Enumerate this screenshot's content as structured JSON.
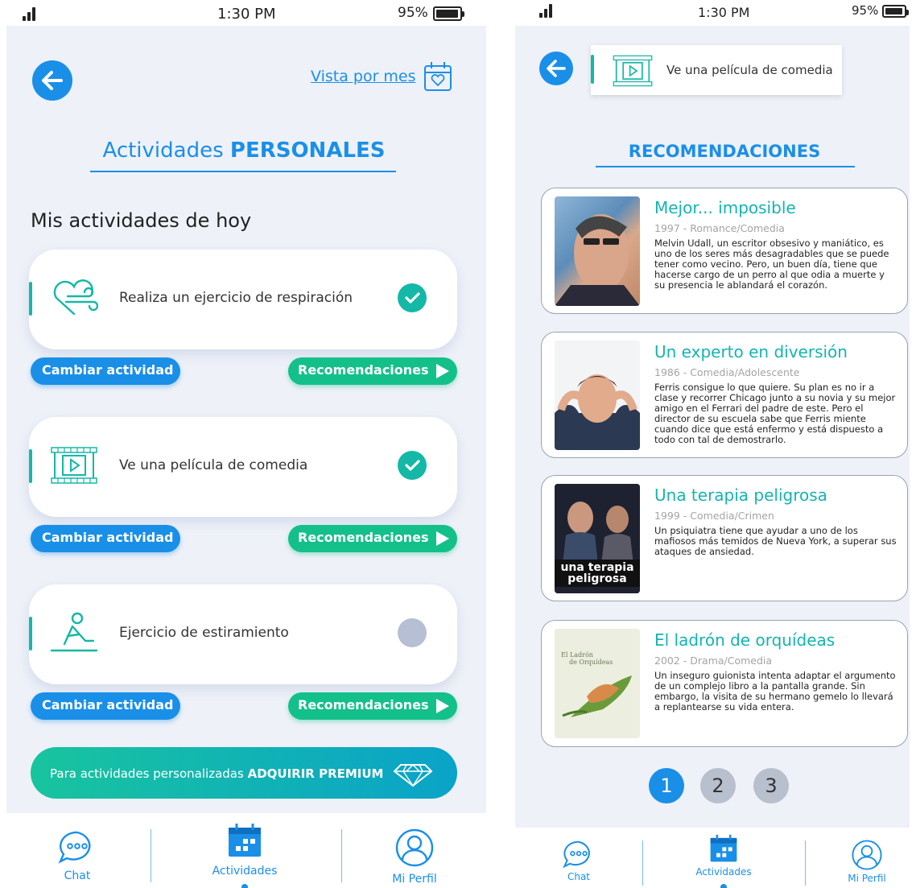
{
  "status_bar": {
    "time": "1:30 PM",
    "battery": "95%"
  },
  "left_screen": {
    "month_view_label": "Vista por mes",
    "title_normal": "Actividades",
    "title_bold": "PERSONALES",
    "section_heading": "Mis actividades de hoy",
    "activities": [
      {
        "label": "Realiza un ejercicio de respiración",
        "icon": "heart-breath-icon",
        "done": true
      },
      {
        "label": "Ve una película de comedia",
        "icon": "film-icon",
        "done": true
      },
      {
        "label": "Ejercicio de estiramiento",
        "icon": "stretch-icon",
        "done": false
      }
    ],
    "change_label": "Cambiar actividad",
    "reco_label": "Recomendaciones",
    "premium_text": "Para actividades personalizadas",
    "premium_bold": "ADQUIRIR PREMIUM"
  },
  "right_screen": {
    "header_activity": "Ve una película de comedia",
    "title": "RECOMENDACIONES",
    "movies": [
      {
        "title": "Mejor... imposible",
        "meta": "1997 - Romance/Comedia",
        "desc": "Melvin Udall, un escritor obsesivo y maniático, es uno de los seres más desagradables que se puede tener como vecino. Pero, un buen día, tiene que hacerse cargo de un perro al que odia a muerte y su presencia le ablandará el corazón."
      },
      {
        "title": "Un experto en diversión",
        "meta": "1986 - Comedia/Adolescente",
        "desc": "Ferris consigue lo que quiere. Su plan es no ir a clase y recorrer Chicago junto a su novia y su mejor amigo en el Ferrari del padre de este. Pero el director de su escuela sabe que Ferris miente cuando dice que está enfermo y está dispuesto a todo con tal de demostrarlo."
      },
      {
        "title": "Una terapia peligrosa",
        "meta": "1999 - Comedia/Crimen",
        "desc": "Un psiquiatra tiene que ayudar a uno de los mafiosos más temidos de Nueva York, a superar sus ataques de ansiedad.",
        "poster_text_1": "una terapia",
        "poster_text_2": "peligrosa"
      },
      {
        "title": "El ladrón de orquídeas",
        "meta": "2002 - Drama/Comedia",
        "desc": "Un inseguro guionista intenta adaptar el argumento de un complejo libro a la pantalla grande. Sin embargo, la visita de su hermano gemelo lo llevará a replantearse su vida entera.",
        "poster_text_1": "El Ladrón",
        "poster_text_2": "de Orquídeas"
      }
    ],
    "pages": [
      "1",
      "2",
      "3"
    ]
  },
  "nav": {
    "chat": "Chat",
    "activities": "Actividades",
    "profile": "Mi Perfil"
  },
  "colors": {
    "blue": "#1a8fe8",
    "teal": "#14b8a6",
    "green": "#14c08a",
    "grey": "#b6bfd3"
  }
}
